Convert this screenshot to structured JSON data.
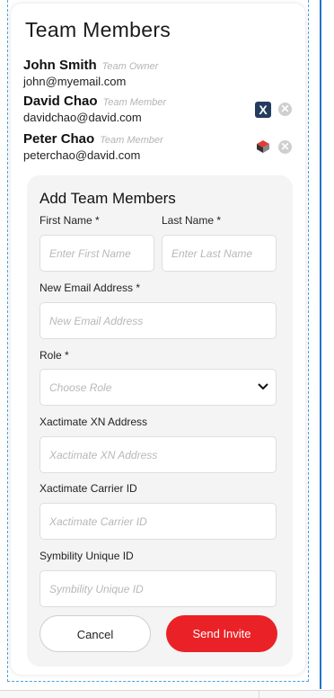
{
  "header": {
    "title": "Team Members"
  },
  "members": [
    {
      "name": "John Smith",
      "role": "Team Owner",
      "email": "john@myemail.com",
      "badge": null
    },
    {
      "name": "David Chao",
      "role": "Team Member",
      "email": "davidchao@david.com",
      "badge": "xactimate-icon"
    },
    {
      "name": "Peter Chao",
      "role": "Team Member",
      "email": "peterchao@david.com",
      "badge": "symbility-icon"
    }
  ],
  "form": {
    "title": "Add Team Members",
    "first_name": {
      "label": "First Name *",
      "placeholder": "Enter First Name"
    },
    "last_name": {
      "label": "Last Name *",
      "placeholder": "Enter Last Name"
    },
    "email": {
      "label": "New Email Address *",
      "placeholder": "New Email Address"
    },
    "role": {
      "label": "Role *",
      "placeholder": "Choose Role"
    },
    "xn_address": {
      "label": "Xactimate XN Address",
      "placeholder": "Xactimate XN Address"
    },
    "carrier_id": {
      "label": "Xactimate Carrier ID",
      "placeholder": "Xactimate Carrier ID"
    },
    "symbility_id": {
      "label": "Symbility Unique ID",
      "placeholder": "Symbility Unique ID"
    },
    "cancel_label": "Cancel",
    "send_label": "Send Invite"
  },
  "colors": {
    "accent": "#ea2227",
    "xactimate": "#243b5e",
    "remove": "#cfcfcf"
  }
}
